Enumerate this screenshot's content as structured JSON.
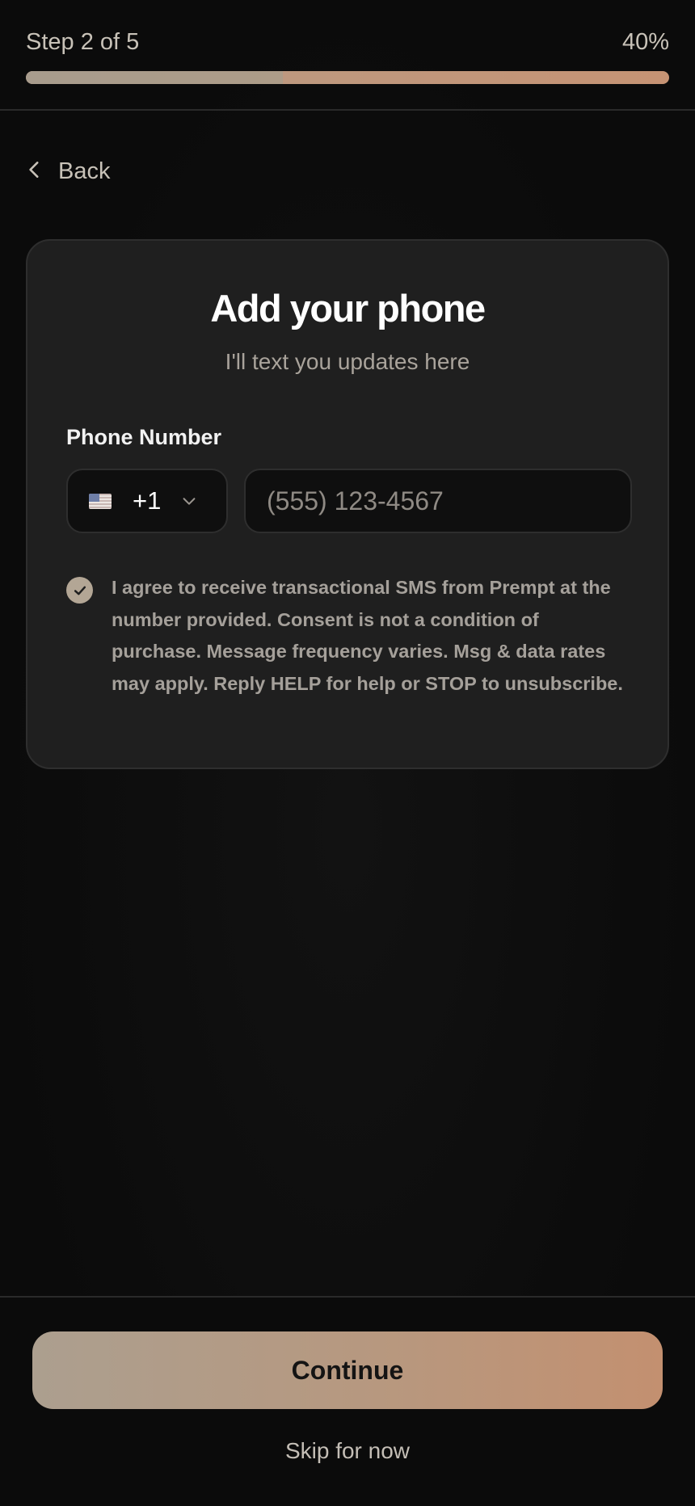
{
  "progress": {
    "step_label": "Step 2 of 5",
    "percent_label": "40%",
    "value": 0.4
  },
  "nav": {
    "back_label": "Back",
    "back_icon": "chevron-left-icon"
  },
  "card": {
    "title": "Add your phone",
    "subtitle": "I'll text you updates here",
    "field_label": "Phone Number",
    "country": {
      "flag_icon": "us-flag-icon",
      "code": "+1",
      "chevron_icon": "chevron-down-icon"
    },
    "phone": {
      "value": "",
      "placeholder": "(555) 123-4567"
    },
    "consent": {
      "checked": true,
      "text": "I agree to receive transactional SMS from Prempt at the number provided. Consent is not a condition of purchase. Message frequency varies. Msg & data rates may apply. Reply HELP for help or STOP to unsubscribe."
    }
  },
  "footer": {
    "continue_label": "Continue",
    "skip_label": "Skip for now"
  },
  "colors": {
    "background": "#0b0b0b",
    "card": "#1f1f1f",
    "accent_start": "#ac9f8f",
    "accent_end": "#c39070",
    "muted_text": "#a5a09a"
  }
}
